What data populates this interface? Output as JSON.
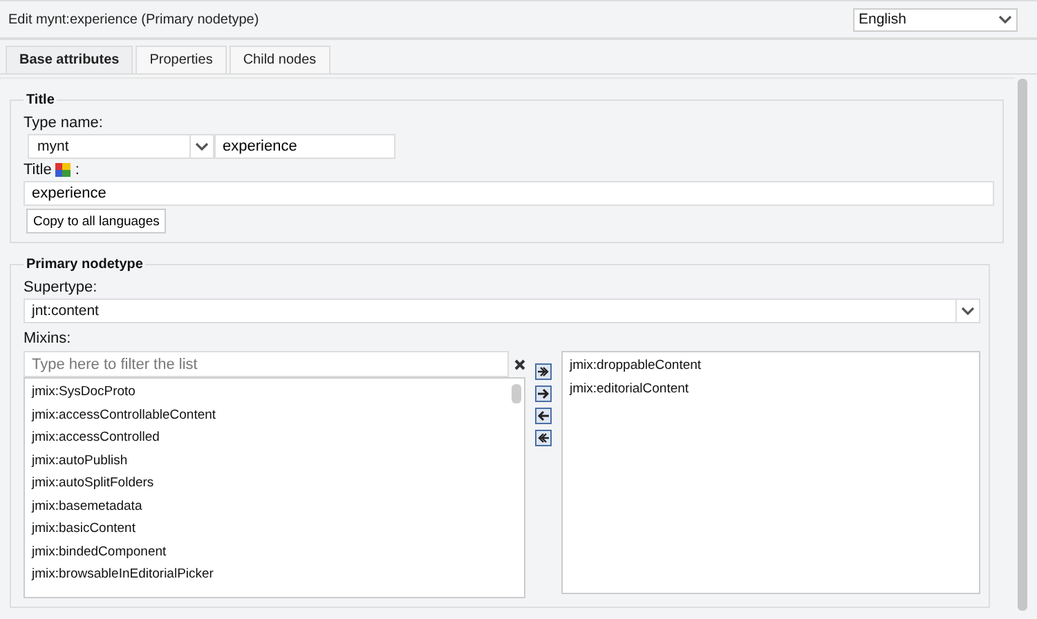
{
  "window": {
    "title": "Edit mynt:experience (Primary nodetype)"
  },
  "language": {
    "value": "English"
  },
  "tabs": [
    {
      "label": "Base attributes",
      "selected": true
    },
    {
      "label": "Properties",
      "selected": false
    },
    {
      "label": "Child nodes",
      "selected": false
    }
  ],
  "title_section": {
    "legend": "Title",
    "type_name_label": "Type name:",
    "prefix": "mynt",
    "name": "experience",
    "title_label": "Title",
    "title_colon": ":",
    "title_value": "experience",
    "copy_button": "Copy to all languages"
  },
  "primary_section": {
    "legend": "Primary nodetype",
    "supertype_label": "Supertype:",
    "supertype": "jnt:content",
    "mixins_label": "Mixins:",
    "filter": {
      "placeholder": "Type here to filter the list"
    },
    "available_mixins": [
      "jmix:SysDocProto",
      "jmix:accessControllableContent",
      "jmix:accessControlled",
      "jmix:autoPublish",
      "jmix:autoSplitFolders",
      "jmix:basemetadata",
      "jmix:basicContent",
      "jmix:bindedComponent",
      "jmix:browsableInEditorialPicker"
    ],
    "selected_mixins": [
      "jmix:droppableContent",
      "jmix:editorialContent"
    ]
  }
}
